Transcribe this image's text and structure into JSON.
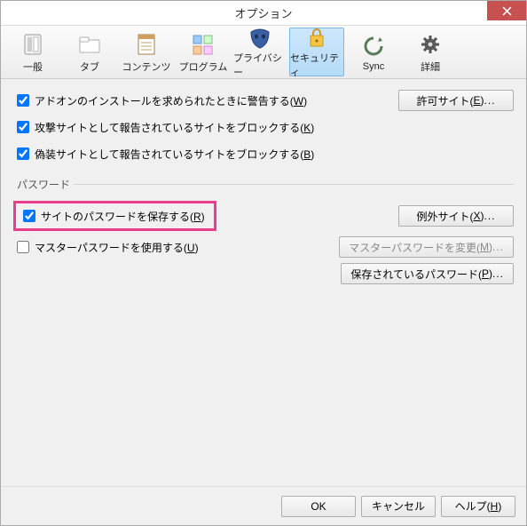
{
  "window": {
    "title": "オプション"
  },
  "toolbar": {
    "items": [
      {
        "label": "一般",
        "icon": "switch"
      },
      {
        "label": "タブ",
        "icon": "folder"
      },
      {
        "label": "コンテンツ",
        "icon": "page"
      },
      {
        "label": "プログラム",
        "icon": "apps"
      },
      {
        "label": "プライバシー",
        "icon": "mask"
      },
      {
        "label": "セキュリティ",
        "icon": "lock",
        "selected": true
      },
      {
        "label": "Sync",
        "icon": "sync"
      },
      {
        "label": "詳細",
        "icon": "gear"
      }
    ]
  },
  "security": {
    "warn_addon": {
      "label": "アドオンのインストールを求められたときに警告する(",
      "accel": "W",
      "tail": ")",
      "checked": true
    },
    "block_attack": {
      "label": "攻撃サイトとして報告されているサイトをブロックする(",
      "accel": "K",
      "tail": ")",
      "checked": true
    },
    "block_forgery": {
      "label": "偽装サイトとして報告されているサイトをブロックする(",
      "accel": "B",
      "tail": ")",
      "checked": true
    },
    "exceptions_btn": {
      "label": "許可サイト(",
      "accel": "E",
      "tail": ")",
      "ellipsis": "..."
    }
  },
  "passwords": {
    "legend": "パスワード",
    "remember": {
      "label": "サイトのパスワードを保存する(",
      "accel": "R",
      "tail": ")",
      "checked": true
    },
    "use_master": {
      "label": "マスターパスワードを使用する(",
      "accel": "U",
      "tail": ")",
      "checked": false
    },
    "exceptions_btn": {
      "label": "例外サイト(",
      "accel": "X",
      "tail": ")",
      "ellipsis": "..."
    },
    "change_master_btn": {
      "label": "マスターパスワードを変更(",
      "accel": "M",
      "tail": ")",
      "ellipsis": "...",
      "disabled": true
    },
    "saved_btn": {
      "label": "保存されているパスワード(",
      "accel": "P",
      "tail": ")",
      "ellipsis": "..."
    }
  },
  "footer": {
    "ok": "OK",
    "cancel": "キャンセル",
    "help": {
      "label": "ヘルプ(",
      "accel": "H",
      "tail": ")"
    }
  }
}
